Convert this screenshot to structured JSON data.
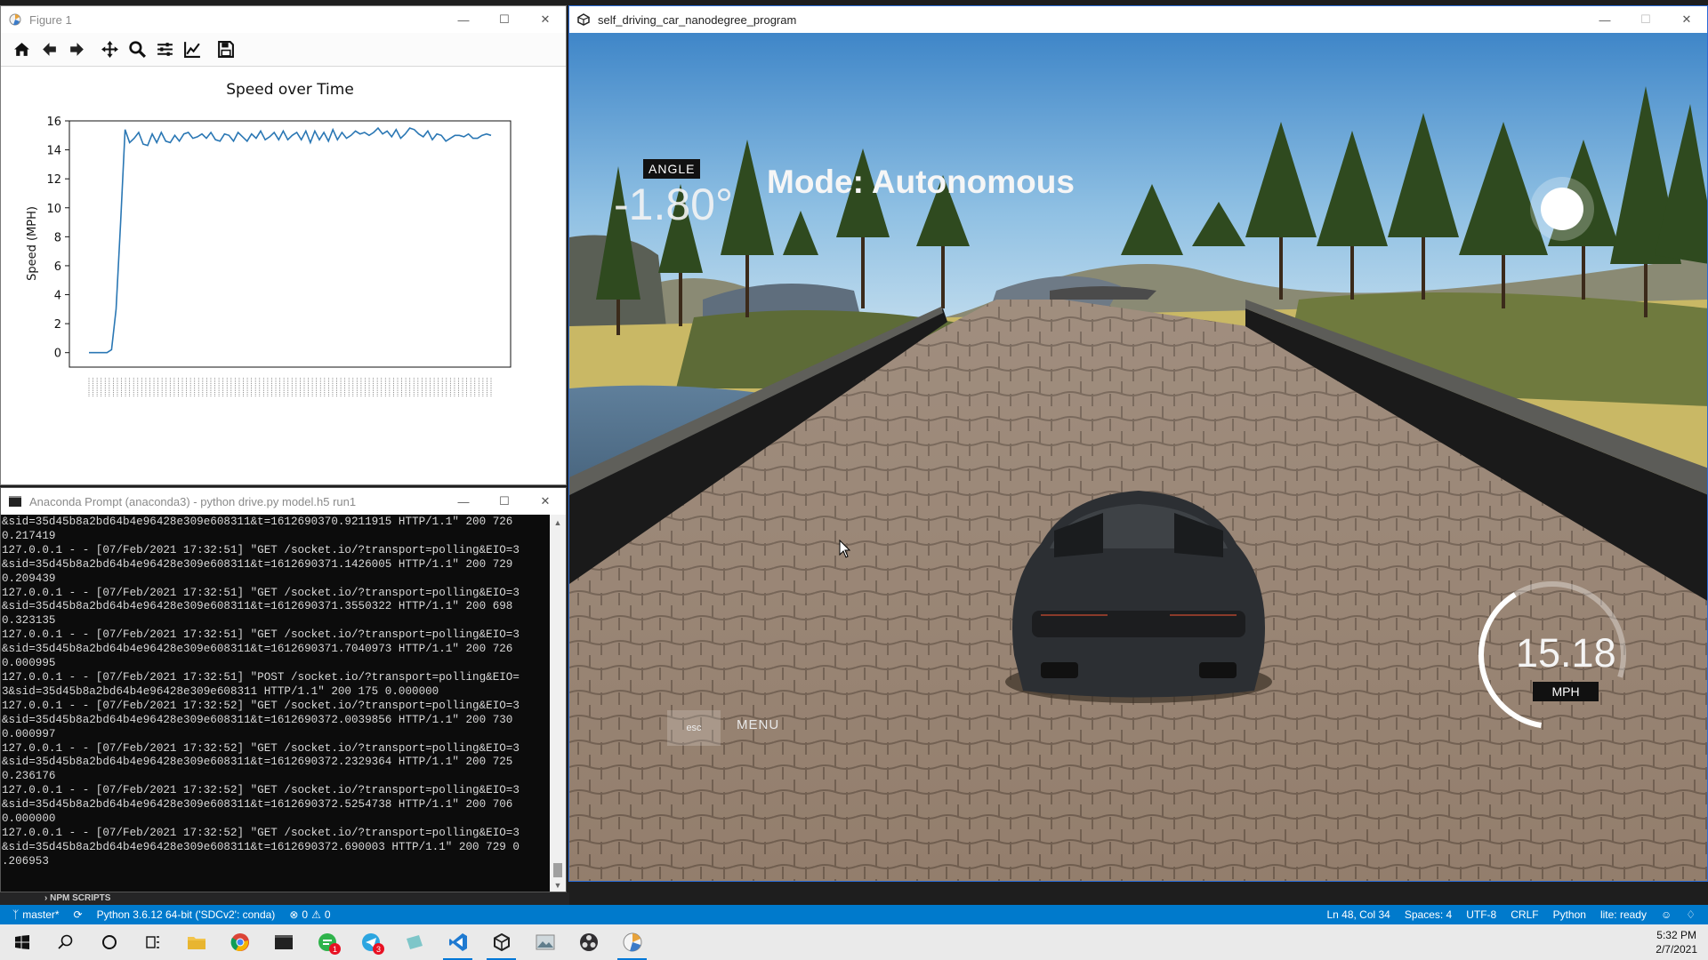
{
  "figure_window": {
    "title": "Figure 1",
    "toolbar": [
      "home-icon",
      "back-arrow-icon",
      "forward-arrow-icon",
      "pan-icon",
      "zoom-icon",
      "subplots-config-icon",
      "edit-axes-icon",
      "save-icon"
    ]
  },
  "chart_data": {
    "type": "line",
    "title": "Speed over Time",
    "ylabel": "Speed (MPH)",
    "xlabel": "",
    "ylim": [
      -1,
      16
    ],
    "yticks": [
      0,
      2,
      4,
      6,
      8,
      10,
      12,
      14,
      16
    ],
    "grid": false,
    "x_tick_count": 100,
    "series": [
      {
        "color": "#2a77b4",
        "values": [
          0,
          0,
          0,
          0,
          0,
          0.2,
          3,
          9,
          15.4,
          14.5,
          14.8,
          15.2,
          14.4,
          14.3,
          15.1,
          14.5,
          15.2,
          14.6,
          14.5,
          15.0,
          14.6,
          15.1,
          15.2,
          14.8,
          14.9,
          15.1,
          14.8,
          15.2,
          14.7,
          14.6,
          15.1,
          15.0,
          14.6,
          15.2,
          14.9,
          14.6,
          15.1,
          14.8,
          15.3,
          14.7,
          14.9,
          15.2,
          14.7,
          15.3,
          14.7,
          15.0,
          15.2,
          14.7,
          15.3,
          14.5,
          15.3,
          14.7,
          15.2,
          14.6,
          15.4,
          14.7,
          15.2,
          14.8,
          15.0,
          15.3,
          15.1,
          15.2,
          15.0,
          15.2,
          15.5,
          15.1,
          15.3,
          14.9,
          15.4,
          14.8,
          15.1,
          15.5,
          15.4,
          15.1,
          14.9,
          15.3,
          14.7,
          15.1,
          15.0,
          14.6,
          14.8,
          15.0,
          15.0,
          14.9,
          15.1,
          14.8,
          14.8,
          15.0,
          15.1,
          15.0
        ]
      }
    ]
  },
  "cmd_window": {
    "title": "Anaconda Prompt (anaconda3) - python  drive.py model.h5 run1",
    "log_lines": [
      "&sid=35d45b8a2bd64b4e96428e309e608311&t=1612690370.9211915 HTTP/1.1\" 200 726",
      "0.217419",
      "127.0.0.1 - - [07/Feb/2021 17:32:51] \"GET /socket.io/?transport=polling&EIO=3",
      "&sid=35d45b8a2bd64b4e96428e309e608311&t=1612690371.1426005 HTTP/1.1\" 200 729",
      "0.209439",
      "127.0.0.1 - - [07/Feb/2021 17:32:51] \"GET /socket.io/?transport=polling&EIO=3",
      "&sid=35d45b8a2bd64b4e96428e309e608311&t=1612690371.3550322 HTTP/1.1\" 200 698",
      "0.323135",
      "127.0.0.1 - - [07/Feb/2021 17:32:51] \"GET /socket.io/?transport=polling&EIO=3",
      "&sid=35d45b8a2bd64b4e96428e309e608311&t=1612690371.7040973 HTTP/1.1\" 200 726",
      "0.000995",
      "127.0.0.1 - - [07/Feb/2021 17:32:51] \"POST /socket.io/?transport=polling&EIO=",
      "3&sid=35d45b8a2bd64b4e96428e309e608311 HTTP/1.1\" 200 175 0.000000",
      "127.0.0.1 - - [07/Feb/2021 17:32:52] \"GET /socket.io/?transport=polling&EIO=3",
      "&sid=35d45b8a2bd64b4e96428e309e608311&t=1612690372.0039856 HTTP/1.1\" 200 730",
      "0.000997",
      "127.0.0.1 - - [07/Feb/2021 17:32:52] \"GET /socket.io/?transport=polling&EIO=3",
      "&sid=35d45b8a2bd64b4e96428e309e608311&t=1612690372.2329364 HTTP/1.1\" 200 725",
      "0.236176",
      "127.0.0.1 - - [07/Feb/2021 17:32:52] \"GET /socket.io/?transport=polling&EIO=3",
      "&sid=35d45b8a2bd64b4e96428e309e608311&t=1612690372.5254738 HTTP/1.1\" 200 706",
      "0.000000",
      "127.0.0.1 - - [07/Feb/2021 17:32:52] \"GET /socket.io/?transport=polling&EIO=3",
      "&sid=35d45b8a2bd64b4e96428e309e608311&t=1612690372.690003 HTTP/1.1\" 200 729 0",
      ".206953"
    ]
  },
  "sim_window": {
    "title": "self_driving_car_nanodegree_program",
    "angle_label": "ANGLE",
    "angle_value": "-1.80°",
    "mode_text": "Mode: Autonomous",
    "speed_value": "15.18",
    "speed_unit": "MPH",
    "speed_gauge_fraction": 0.5,
    "esc_label": "esc",
    "menu_label": "MENU"
  },
  "vscode": {
    "npm_scripts": "NPM SCRIPTS",
    "branch": "master*",
    "interpreter": "Python 3.6.12 64-bit ('SDCv2': conda)",
    "errors": "0",
    "warnings": "0",
    "cursor": "Ln 48, Col 34",
    "spaces": "Spaces: 4",
    "encoding": "UTF-8",
    "eol": "CRLF",
    "language": "Python",
    "lint": "lite: ready"
  },
  "taskbar": {
    "icons": [
      "start-icon",
      "search-icon",
      "cortana-icon",
      "task-view-icon",
      "file-explorer-icon",
      "chrome-icon",
      "terminal-icon",
      "chat-app-icon",
      "telegram-icon",
      "notepad-icon",
      "vscode-icon",
      "unity-icon",
      "photos-icon",
      "obs-icon",
      "matplotlib-icon"
    ],
    "chat_badge": "1",
    "telegram_badge": "3",
    "time": "5:32 PM",
    "date": "2/7/2021"
  }
}
